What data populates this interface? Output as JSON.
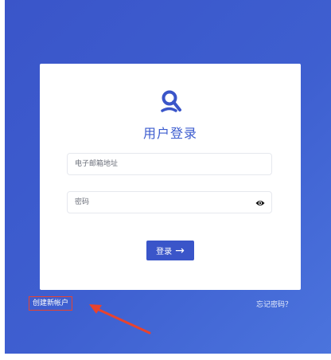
{
  "login": {
    "title": "用户登录",
    "email_placeholder": "电子邮箱地址",
    "password_placeholder": "密码",
    "submit_label": "登录",
    "submit_arrow": "→"
  },
  "footer": {
    "create_account": "创建新帐户",
    "forgot_password": "忘记密码？"
  },
  "colors": {
    "brand_blue": "#3a55c9",
    "background_gradient_end": "#4b74dd",
    "highlight_red": "#e8432f"
  },
  "icons": {
    "logo": "logo-icon",
    "password_toggle": "eye-icon",
    "submit": "arrow-right-icon"
  }
}
